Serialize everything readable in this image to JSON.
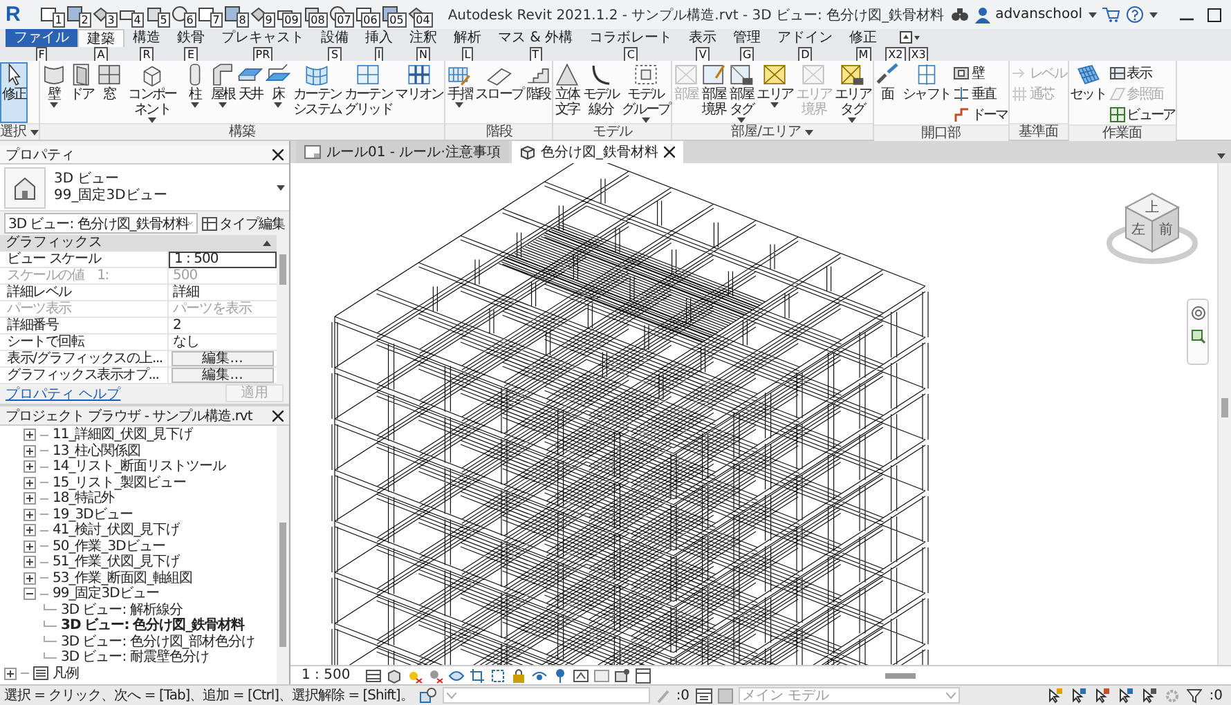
{
  "app_logo": "R",
  "quick_access_keytips": [
    "1",
    "2",
    "3",
    "4",
    "5",
    "6",
    "7",
    "8",
    "9",
    "09",
    "08",
    "07",
    "06",
    "05",
    "04"
  ],
  "title": "Autodesk Revit 2021.1.2 - サンプル構造.rvt - 3D ビュー: 色分け図_鉄骨材料",
  "user": "advanschool",
  "ribbon_tabs": [
    {
      "label": "ファイル",
      "keytip": "F",
      "kind": "file",
      "selected": false
    },
    {
      "label": "建築",
      "keytip": "A",
      "kind": "tab",
      "selected": true
    },
    {
      "label": "構造",
      "keytip": "R",
      "kind": "tab",
      "selected": false
    },
    {
      "label": "鉄骨",
      "keytip": "E",
      "kind": "tab",
      "selected": false
    },
    {
      "label": "プレキャスト",
      "keytip": "PR",
      "kind": "tab",
      "selected": false
    },
    {
      "label": "設備",
      "keytip": "S",
      "kind": "tab",
      "selected": false
    },
    {
      "label": "挿入",
      "keytip": "I",
      "kind": "tab",
      "selected": false
    },
    {
      "label": "注釈",
      "keytip": "N",
      "kind": "tab",
      "selected": false
    },
    {
      "label": "解析",
      "keytip": "L",
      "kind": "tab",
      "selected": false
    },
    {
      "label": "マス & 外構",
      "keytip": "T",
      "kind": "tab",
      "selected": false
    },
    {
      "label": "コラボレート",
      "keytip": "C",
      "kind": "tab",
      "selected": false
    },
    {
      "label": "表示",
      "keytip": "V",
      "kind": "tab",
      "selected": false
    },
    {
      "label": "管理",
      "keytip": "G",
      "kind": "tab",
      "selected": false
    },
    {
      "label": "アドイン",
      "keytip": "D",
      "kind": "tab",
      "selected": false
    },
    {
      "label": "修正",
      "keytip": "M",
      "kind": "tab",
      "selected": false
    }
  ],
  "ribbon_toggle_keytips": [
    "X2",
    "X3"
  ],
  "panels": [
    {
      "title": "選択",
      "has_menu": true,
      "tools": [
        {
          "lines": [
            "修正"
          ],
          "kind": "large",
          "dropdown": false,
          "disabled": false,
          "selected": true
        }
      ]
    },
    {
      "title": "構築",
      "has_menu": false,
      "tools": [
        {
          "lines": [
            "壁"
          ],
          "kind": "large",
          "dropdown": true,
          "disabled": false,
          "selected": false
        },
        {
          "lines": [
            "ドア"
          ],
          "kind": "large",
          "dropdown": false,
          "disabled": false,
          "selected": false
        },
        {
          "lines": [
            "窓"
          ],
          "kind": "large",
          "dropdown": false,
          "disabled": false,
          "selected": false
        },
        {
          "lines": [
            "コンポーネント"
          ],
          "kind": "large",
          "dropdown": true,
          "disabled": false,
          "selected": false
        },
        {
          "lines": [
            "柱"
          ],
          "kind": "large",
          "dropdown": true,
          "disabled": false,
          "selected": false
        },
        {
          "lines": [
            "屋根"
          ],
          "kind": "large",
          "dropdown": true,
          "disabled": false,
          "selected": false
        },
        {
          "lines": [
            "天井"
          ],
          "kind": "large",
          "dropdown": false,
          "disabled": false,
          "selected": false
        },
        {
          "lines": [
            "床"
          ],
          "kind": "large",
          "dropdown": true,
          "disabled": false,
          "selected": false
        },
        {
          "lines": [
            "カーテン",
            "システム"
          ],
          "kind": "large",
          "dropdown": false,
          "disabled": false,
          "selected": false
        },
        {
          "lines": [
            "カーテン",
            "グリッド"
          ],
          "kind": "large",
          "dropdown": false,
          "disabled": false,
          "selected": false
        },
        {
          "lines": [
            "マリオン"
          ],
          "kind": "large",
          "dropdown": false,
          "disabled": false,
          "selected": false
        }
      ]
    },
    {
      "title": "階段",
      "has_menu": false,
      "tools": [
        {
          "lines": [
            "手摺"
          ],
          "kind": "large",
          "dropdown": true,
          "disabled": false,
          "selected": false
        },
        {
          "lines": [
            "スロープ"
          ],
          "kind": "large",
          "dropdown": false,
          "disabled": false,
          "selected": false
        },
        {
          "lines": [
            "階段"
          ],
          "kind": "large",
          "dropdown": false,
          "disabled": false,
          "selected": false
        }
      ]
    },
    {
      "title": "モデル",
      "has_menu": false,
      "tools": [
        {
          "lines": [
            "立体",
            "文字"
          ],
          "kind": "large",
          "dropdown": false,
          "disabled": false,
          "selected": false
        },
        {
          "lines": [
            "モデル",
            "線分"
          ],
          "kind": "large",
          "dropdown": false,
          "disabled": false,
          "selected": false
        },
        {
          "lines": [
            "モデル",
            "グループ"
          ],
          "kind": "large",
          "dropdown": true,
          "disabled": false,
          "selected": false
        }
      ]
    },
    {
      "title": "部屋/エリア",
      "has_menu": true,
      "tools": [
        {
          "lines": [
            "部屋"
          ],
          "kind": "large",
          "dropdown": false,
          "disabled": true,
          "selected": false
        },
        {
          "lines": [
            "部屋",
            "境界"
          ],
          "kind": "large",
          "dropdown": false,
          "disabled": false,
          "selected": false
        },
        {
          "lines": [
            "部屋",
            "タグ"
          ],
          "kind": "large",
          "dropdown": true,
          "disabled": false,
          "selected": false
        },
        {
          "lines": [
            "エリア"
          ],
          "kind": "large",
          "dropdown": true,
          "disabled": false,
          "selected": false
        },
        {
          "lines": [
            "エリア",
            "境界"
          ],
          "kind": "large",
          "dropdown": false,
          "disabled": true,
          "selected": false
        },
        {
          "lines": [
            "エリア",
            "タグ"
          ],
          "kind": "large",
          "dropdown": true,
          "disabled": false,
          "selected": false
        }
      ]
    },
    {
      "title": "開口部",
      "has_menu": false,
      "tools": [
        {
          "lines": [
            "面"
          ],
          "kind": "large",
          "dropdown": false,
          "disabled": false,
          "selected": false
        },
        {
          "lines": [
            "シャフト"
          ],
          "kind": "large",
          "dropdown": false,
          "disabled": false,
          "selected": false
        },
        {
          "lines": [
            "壁"
          ],
          "kind": "small",
          "dropdown": false,
          "disabled": false,
          "selected": false
        },
        {
          "lines": [
            "垂直"
          ],
          "kind": "small",
          "dropdown": false,
          "disabled": false,
          "selected": false
        },
        {
          "lines": [
            "ドーマ"
          ],
          "kind": "small",
          "dropdown": false,
          "disabled": false,
          "selected": false
        }
      ]
    },
    {
      "title": "基準面",
      "has_menu": false,
      "tools": [
        {
          "lines": [
            "レベル"
          ],
          "kind": "small",
          "dropdown": false,
          "disabled": true,
          "selected": false
        },
        {
          "lines": [
            "通芯"
          ],
          "kind": "small",
          "dropdown": false,
          "disabled": true,
          "selected": false
        }
      ]
    },
    {
      "title": "作業面",
      "has_menu": false,
      "tools": [
        {
          "lines": [
            "セット"
          ],
          "kind": "large",
          "dropdown": false,
          "disabled": false,
          "selected": false
        },
        {
          "lines": [
            "表示"
          ],
          "kind": "small",
          "dropdown": false,
          "disabled": false,
          "selected": false
        },
        {
          "lines": [
            "参照面"
          ],
          "kind": "small",
          "dropdown": false,
          "disabled": true,
          "selected": false
        },
        {
          "lines": [
            "ビューア"
          ],
          "kind": "small",
          "dropdown": false,
          "disabled": false,
          "selected": false
        }
      ]
    }
  ],
  "properties": {
    "title": "プロパティ",
    "type_lines": [
      "3D ビュー",
      "99_固定3Dビュー"
    ],
    "instance": "3D ビュー: 色分け図_鉄骨材料",
    "edit_type": "タイプ編集",
    "group": "グラフィックス",
    "rows": [
      {
        "label": "ビュー スケール",
        "value": "1 : 500",
        "kind": "field",
        "disabled": false
      },
      {
        "label": "スケールの値　1:",
        "value": "500",
        "kind": "text",
        "disabled": true
      },
      {
        "label": "詳細レベル",
        "value": "詳細",
        "kind": "text",
        "disabled": false
      },
      {
        "label": "パーツ表示",
        "value": "パーツを表示",
        "kind": "text",
        "disabled": true
      },
      {
        "label": "詳細番号",
        "value": "2",
        "kind": "text",
        "disabled": false
      },
      {
        "label": "シートで回転",
        "value": "なし",
        "kind": "text",
        "disabled": false
      },
      {
        "label": "表示/グラフィックスの上...",
        "value": "編集...",
        "kind": "button",
        "disabled": false
      },
      {
        "label": "グラフィックス表示オプ...",
        "value": "編集...",
        "kind": "button",
        "disabled": false
      }
    ],
    "help_link": "プロパティ ヘルプ",
    "apply": "適用",
    "apply_disabled": true
  },
  "project_browser": {
    "title": "プロジェクト ブラウザ - サンプル構造.rvt",
    "tree": [
      {
        "children": [
          {
            "label": "11_詳細図_伏図_見下げ",
            "kind": "folder",
            "expanded": false,
            "selected": false
          },
          {
            "label": "13_柱心関係図",
            "kind": "folder",
            "expanded": false,
            "selected": false
          },
          {
            "label": "14_リスト_断面リストツール",
            "kind": "folder",
            "expanded": false,
            "selected": false
          },
          {
            "label": "15_リスト_製図ビュー",
            "kind": "folder",
            "expanded": false,
            "selected": false
          },
          {
            "label": "18_特記外",
            "kind": "folder",
            "expanded": false,
            "selected": false
          },
          {
            "label": "19_3Dビュー",
            "kind": "folder",
            "expanded": false,
            "selected": false
          },
          {
            "label": "41_検討_伏図_見下げ",
            "kind": "folder",
            "expanded": false,
            "selected": false
          },
          {
            "label": "50_作業_3Dビュー",
            "kind": "folder",
            "expanded": false,
            "selected": false
          },
          {
            "label": "51_作業_伏図_見下げ",
            "kind": "folder",
            "expanded": false,
            "selected": false
          },
          {
            "label": "53_作業_断面図_軸組図",
            "kind": "folder",
            "expanded": false,
            "selected": false
          },
          {
            "label": "99_固定3Dビュー",
            "kind": "folder",
            "expanded": true,
            "selected": false,
            "children": [
              {
                "label": "3D ビュー: 解析線分",
                "kind": "view",
                "selected": false
              },
              {
                "label": "3D ビュー: 色分け図_鉄骨材料",
                "kind": "view",
                "selected": true
              },
              {
                "label": "3D ビュー: 色分け図_部材色分け",
                "kind": "view",
                "selected": false
              },
              {
                "label": "3D ビュー: 耐震壁色分け",
                "kind": "view",
                "selected": false
              }
            ]
          }
        ]
      },
      {
        "label": "凡例",
        "kind": "legend",
        "expanded": false,
        "selected": false
      }
    ]
  },
  "view_tabs": [
    {
      "label": "ルール01 - ルール·注意事項",
      "selected": false
    },
    {
      "label": "色分け図_鉄骨材料",
      "selected": true
    }
  ],
  "viewcube_faces": [
    "上",
    "左",
    "前"
  ],
  "view_scale": "1 : 500",
  "status_bar": {
    "message": "選択 = クリック、次へ = [Tab]、追加 = [Ctrl]、選択解除 = [Shift]。",
    "editable_count": ":0",
    "design_option": "メイン モデル",
    "filter_count": ":0"
  }
}
